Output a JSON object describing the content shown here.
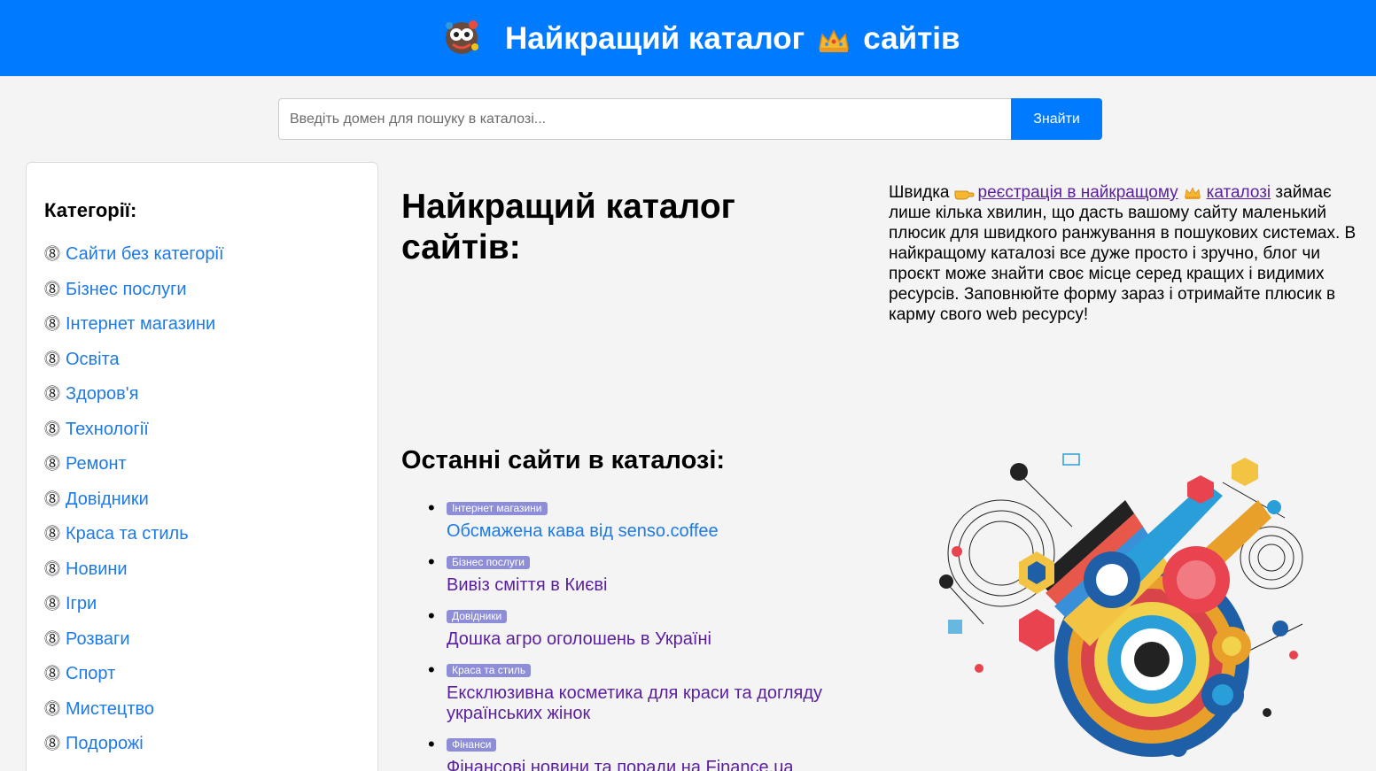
{
  "header": {
    "title_part1": "Найкращий каталог",
    "title_part2": "сайтів"
  },
  "search": {
    "placeholder": "Введіть домен для пошуку в каталозі...",
    "button_label": "Знайти"
  },
  "sidebar": {
    "heading": "Категорії:",
    "items": [
      {
        "label": "Сайти без категорії"
      },
      {
        "label": "Бізнес послуги"
      },
      {
        "label": "Інтернет магазини"
      },
      {
        "label": "Освіта"
      },
      {
        "label": "Здоров'я"
      },
      {
        "label": "Технології"
      },
      {
        "label": "Ремонт"
      },
      {
        "label": "Довідники"
      },
      {
        "label": "Краса та стиль"
      },
      {
        "label": "Новини"
      },
      {
        "label": "Ігри"
      },
      {
        "label": "Розваги"
      },
      {
        "label": "Спорт"
      },
      {
        "label": "Мистецтво"
      },
      {
        "label": "Подорожі"
      }
    ]
  },
  "main": {
    "title": "Найкращий каталог сайтів:",
    "intro_before": "Швидка",
    "intro_link_part1": "реєстрація в найкращому",
    "intro_link_part2": "каталозі",
    "intro_after": "займає лише кілька хвилин, що дасть вашому сайту маленький плюсик для швидкого ранжування в пошукових системах. В найкращому каталозі все дуже просто і зручно, блог чи проєкт може знайти своє місце серед кращих і видимих ресурсів. Заповнюйте форму зараз і отримайте плюсик в карму свого web ресурсу!",
    "recent_title": "Останні сайти в каталозі:",
    "recent": [
      {
        "category": "Інтернет магазини",
        "title": "Обсмажена кава від senso.coffee"
      },
      {
        "category": "Бізнес послуги",
        "title": "Вивіз сміття в Києві"
      },
      {
        "category": "Довідники",
        "title": "Дошка агро оголошень в Україні"
      },
      {
        "category": "Краса та стиль",
        "title": "Ексклюзивна косметика для краси та догляду українських жінок"
      },
      {
        "category": "Фінанси",
        "title": "Фінансові новини та поради на Finance.ua"
      }
    ]
  },
  "colors": {
    "brand": "#007bff",
    "link": "#1e7ae6",
    "visited_link": "#5a1f9e",
    "badge": "#8e8ed8"
  },
  "icons": {
    "logo": "mascot-logo-icon",
    "crown": "crown-emoji-icon",
    "hand": "pointing-hand-emoji-icon",
    "bullet": "chain-link-bullet-icon"
  }
}
